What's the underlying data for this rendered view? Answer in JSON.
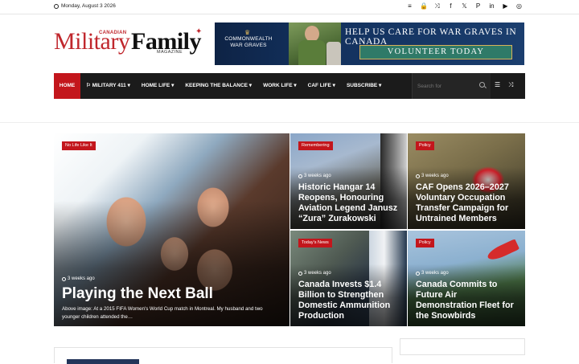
{
  "topbar": {
    "date": "Monday, August 3 2026",
    "icons": [
      "menu-icon",
      "lock-icon",
      "shuffle-icon",
      "facebook-icon",
      "x-icon",
      "pinterest-icon",
      "linkedin-icon",
      "youtube-icon",
      "instagram-icon"
    ]
  },
  "logo": {
    "canadian": "CANADIAN",
    "military": "Military",
    "family": "Family",
    "magazine": "MAGAZINE"
  },
  "banner": {
    "org": "COMMONWEALTH WAR GRAVES",
    "headline": "HELP US CARE FOR WAR GRAVES IN CANADA",
    "cta": "VOLUNTEER TODAY"
  },
  "nav": {
    "items": [
      "HOME",
      "MILITARY 411",
      "HOME LIFE",
      "KEEPING THE BALANCE",
      "WORK LIFE",
      "CAF LIFE",
      "SUBSCRIBE"
    ],
    "search_placeholder": "Search for"
  },
  "featured": [
    {
      "tag": "No Life Like It",
      "time": "3 weeks ago",
      "title": "Playing the Next Ball",
      "excerpt": "Above image: At a 2015 FIFA Women's World Cup match in Montreal. My husband and two younger children attended the…"
    },
    {
      "tag": "Remembering",
      "time": "3 weeks ago",
      "title": "Historic Hangar 14 Reopens, Honouring Aviation Legend Janusz “Zura” Zurakowski"
    },
    {
      "tag": "Policy",
      "time": "3 weeks ago",
      "title": "CAF Opens 2026–2027 Voluntary Occupation Transfer Campaign for Untrained Members"
    },
    {
      "tag": "Today's News",
      "time": "3 weeks ago",
      "title": "Canada Invests $1.4 Billion to Strengthen Domestic Ammunition Production"
    },
    {
      "tag": "Policy",
      "time": "3 weeks ago",
      "title": "Canada Commits to Future Air Demonstration Fleet for the Snowbirds"
    }
  ],
  "colors": {
    "accent": "#c3161c",
    "nav_bg": "#1b1b1b",
    "brand_red": "#c0272d"
  }
}
